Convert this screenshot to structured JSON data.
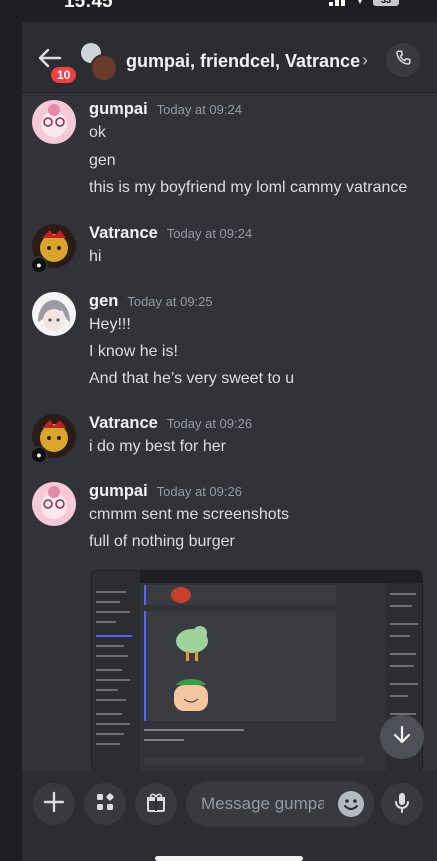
{
  "status": {
    "time": "15:45",
    "battery": "33"
  },
  "header": {
    "title": "gumpai, friendcel, Vatrance",
    "unread_badge": "10"
  },
  "messages": [
    {
      "author": "gumpai",
      "timestamp": "Today at 09:24",
      "lines": [
        "ok",
        "gen",
        "this is my boyfriend my loml cammy vatrance"
      ]
    },
    {
      "author": "Vatrance",
      "timestamp": "Today at 09:24",
      "lines": [
        "hi"
      ]
    },
    {
      "author": "gen",
      "timestamp": "Today at 09:25",
      "lines": [
        "Hey!!!",
        "I know he is!",
        "And that he’s very sweet to u"
      ]
    },
    {
      "author": "Vatrance",
      "timestamp": "Today at 09:26",
      "lines": [
        "i do my best for her"
      ]
    },
    {
      "author": "gumpai",
      "timestamp": "Today at 09:26",
      "lines": [
        "cmmm sent me screenshots",
        "full of nothing burger"
      ]
    }
  ],
  "composer": {
    "placeholder": "Message gumpai,.."
  },
  "icons": {
    "back": "arrow-left-icon",
    "call": "phone-icon",
    "add": "plus-icon",
    "apps": "apps-icon",
    "gift": "gift-icon",
    "emoji": "emoji-icon",
    "mic": "microphone-icon",
    "scroll": "arrow-down-icon"
  },
  "colors": {
    "background": "#313338",
    "header": "#2b2d31",
    "badge": "#f23f43",
    "input": "#383a40"
  }
}
